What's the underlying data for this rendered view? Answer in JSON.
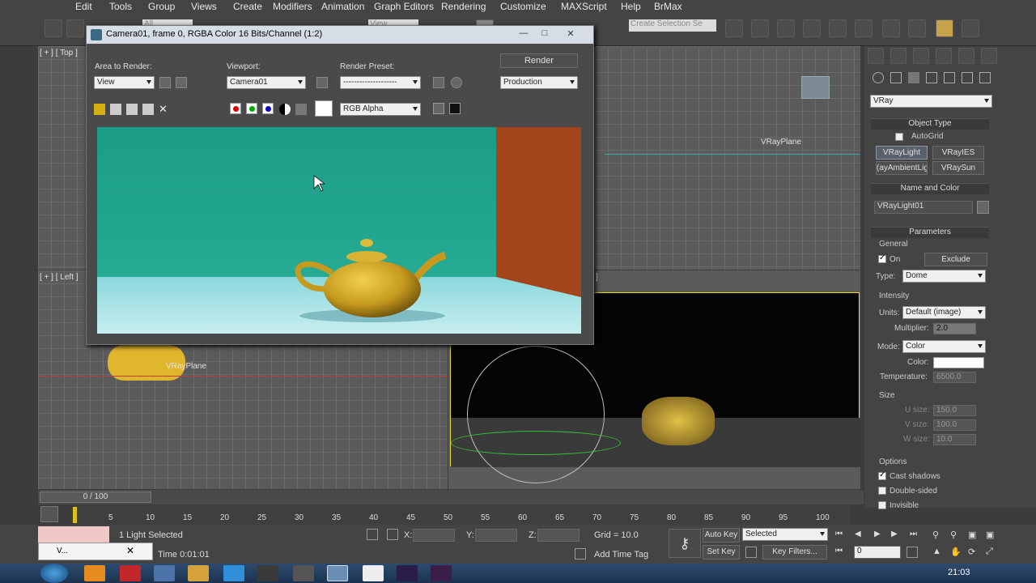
{
  "menu": [
    "Edit",
    "Tools",
    "Group",
    "Views",
    "Create",
    "Modifiers",
    "Animation",
    "Graph Editors",
    "Rendering",
    "Customize",
    "MAXScript",
    "Help",
    "BrMax"
  ],
  "toolbar": {
    "selection_filter": "All",
    "ref_coord": "View",
    "named_selection": "Create Selection Se"
  },
  "viewports": {
    "top_label": "[ + ] [ Top ]",
    "left_label": "[ + ] [ Left ]",
    "bracket": "]",
    "plane_label": "VRayPlane",
    "plane_label2": "VRayPlane"
  },
  "dialog": {
    "title": "Camera01, frame 0, RGBA Color 16 Bits/Channel (1:2)",
    "area_label": "Area to Render:",
    "area_value": "View",
    "viewport_label": "Viewport:",
    "viewport_value": "Camera01",
    "preset_label": "Render Preset:",
    "preset_value": "--------------------",
    "render_button": "Render",
    "production_value": "Production",
    "channel_value": "RGB Alpha"
  },
  "command_panel": {
    "renderer": "VRay",
    "object_type": "Object Type",
    "autogrid": "AutoGrid",
    "buttons": [
      "VRayLight",
      "VRayIES",
      "(ayAmbientLig",
      "VRaySun"
    ],
    "name_color": "Name and Color",
    "object_name": "VRayLight01",
    "parameters": "Parameters",
    "general": "General",
    "on": "On",
    "exclude": "Exclude",
    "type_label": "Type:",
    "type_value": "Dome",
    "intensity": "Intensity",
    "units_label": "Units:",
    "units_value": "Default (image)",
    "multiplier_label": "Multiplier:",
    "multiplier_value": "2.0",
    "mode_label": "Mode:",
    "mode_value": "Color",
    "color_label": "Color:",
    "temperature_label": "Temperature:",
    "temperature_value": "6500.0",
    "size": "Size",
    "usize_label": "U size:",
    "usize_value": "150.0",
    "vsize_label": "V size:",
    "vsize_value": "100.0",
    "wsize_label": "W size:",
    "wsize_value": "10.0",
    "options": "Options",
    "cast_shadows": "Cast shadows",
    "double_sided": "Double-sided",
    "invisible": "Invisible"
  },
  "timeline": {
    "frame": "0 / 100",
    "ticks": [
      "5",
      "10",
      "15",
      "20",
      "25",
      "30",
      "35",
      "40",
      "45",
      "50",
      "55",
      "60",
      "65",
      "70",
      "75",
      "80",
      "85",
      "90",
      "95",
      "100"
    ]
  },
  "status": {
    "selected": "1 Light Selected",
    "x_label": "X:",
    "y_label": "Y:",
    "z_label": "Z:",
    "grid": "Grid = 10.0",
    "auto_key": "Auto Key",
    "key_mode": "Selected",
    "set_key": "Set Key",
    "key_filters": "Key Filters...",
    "frame_value": "0",
    "time": "Time  0:01:01",
    "add_time_tag": "Add Time Tag",
    "mini_label": "V..."
  },
  "taskbar": {
    "clock": "21:03"
  }
}
